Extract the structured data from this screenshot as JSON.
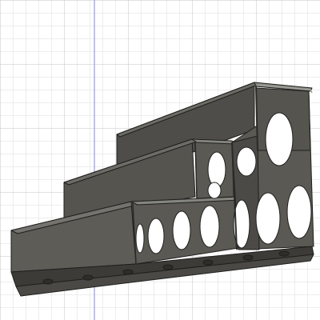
{
  "viewport": {
    "background": "#ffffff",
    "grid_minor_color": "#dedede",
    "grid_major_color": "#c4c4c4",
    "vertical_axis_color": "#9a9ae8",
    "grid": true
  },
  "model": {
    "fill_color": "#5a5954",
    "dark_color": "#3e3d39",
    "light_color": "#858580",
    "edge_color": "#1f1f1d",
    "hole_color": "#ffffff"
  }
}
